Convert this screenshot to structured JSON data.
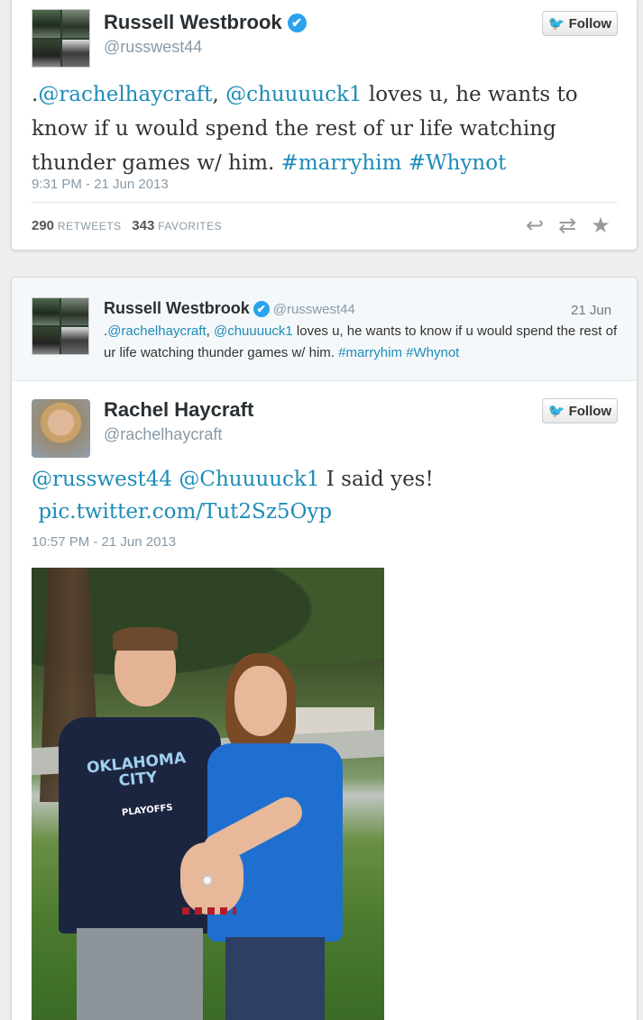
{
  "tweet1": {
    "name": "Russell Westbrook",
    "verified_icon": "✔",
    "handle": "@russwest44",
    "follow_label": "Follow",
    "text_parts": [
      {
        "text": ".",
        "link": false
      },
      {
        "text": "@rachelhaycraft",
        "link": true
      },
      {
        "text": ", ",
        "link": false
      },
      {
        "text": "@chuuuuck1",
        "link": true
      },
      {
        "text": " loves u, he wants to know if u would spend the rest of ur life watching thunder games w/ him. ",
        "link": false
      },
      {
        "text": "#marryhim",
        "link": true
      },
      {
        "text": " ",
        "link": false
      },
      {
        "text": "#Whynot",
        "link": true
      }
    ],
    "timestamp": "9:31 PM - 21 Jun 2013",
    "retweets_count": "290",
    "retweets_label": "RETWEETS",
    "favorites_count": "343",
    "favorites_label": "FAVORITES"
  },
  "tweet2": {
    "quoted": {
      "name": "Russell Westbrook",
      "handle": "@russwest44",
      "date": "21 Jun",
      "text_parts": [
        {
          "text": ".",
          "link": false
        },
        {
          "text": "@rachelhaycraft",
          "link": true
        },
        {
          "text": ", ",
          "link": false
        },
        {
          "text": "@chuuuuck1",
          "link": true
        },
        {
          "text": " loves u, he wants to know if u would spend the rest of ur life watching thunder games w/ him. ",
          "link": false
        },
        {
          "text": "#marryhim",
          "link": true
        },
        {
          "text": " ",
          "link": false
        },
        {
          "text": "#Whynot",
          "link": true
        }
      ]
    },
    "name": "Rachel Haycraft",
    "handle": "@rachelhaycraft",
    "follow_label": "Follow",
    "text_mention1": "@russwest44",
    "text_mention2": "@Chuuuuck1",
    "text_plain": " I said yes!",
    "pic_link": "pic.twitter.com/Tut2Sz5Oyp",
    "timestamp": "10:57 PM - 21 Jun 2013",
    "photo_shirt_text": "OKLAHOMA CITY",
    "photo_shirt_sub": "PLAYOFFS"
  }
}
